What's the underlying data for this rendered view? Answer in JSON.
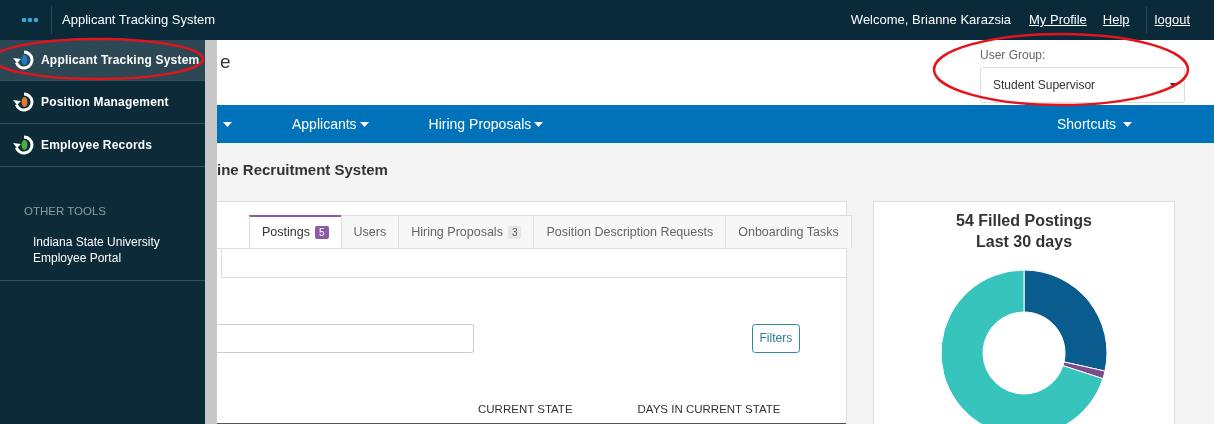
{
  "topbar": {
    "title": "Applicant Tracking System",
    "welcome": "Welcome, Brianne Karazsia",
    "links": [
      "My Profile",
      "Help",
      "logout"
    ]
  },
  "sidebar": {
    "items": [
      {
        "label": "Applicant Tracking System",
        "selected": true,
        "highlighted": true,
        "color": "#1f7ac4"
      },
      {
        "label": "Position Management",
        "selected": false,
        "highlighted": false,
        "color": "#e8762d"
      },
      {
        "label": "Employee Records",
        "selected": false,
        "highlighted": false,
        "color": "#4caf3a"
      }
    ],
    "other_tools": {
      "heading": "OTHER TOOLS",
      "links": [
        "Indiana State University Employee Portal"
      ]
    }
  },
  "header": {
    "title_fragment": "e",
    "user_group": {
      "label": "User Group:",
      "value": "Student Supervisor",
      "highlighted": true
    }
  },
  "nav": {
    "items": [
      {
        "label": "Applicants"
      },
      {
        "label": "Hiring Proposals"
      }
    ],
    "right": "Shortcuts"
  },
  "page_title": "ine Recruitment System",
  "tabs": [
    {
      "label": "Postings",
      "badge": "5",
      "selected": true
    },
    {
      "label": "Users",
      "selected": false
    },
    {
      "label": "Hiring Proposals",
      "badge": "3",
      "selected": false
    },
    {
      "label": "Position Description Requests",
      "selected": false
    },
    {
      "label": "Onboarding Tasks",
      "selected": false
    }
  ],
  "filters_button": "Filters",
  "table": {
    "columns": [
      "CURRENT STATE",
      "DAYS IN CURRENT STATE"
    ]
  },
  "chart_card": {
    "title_lines": [
      "54 Filled Postings",
      "Last 30 days"
    ]
  }
}
